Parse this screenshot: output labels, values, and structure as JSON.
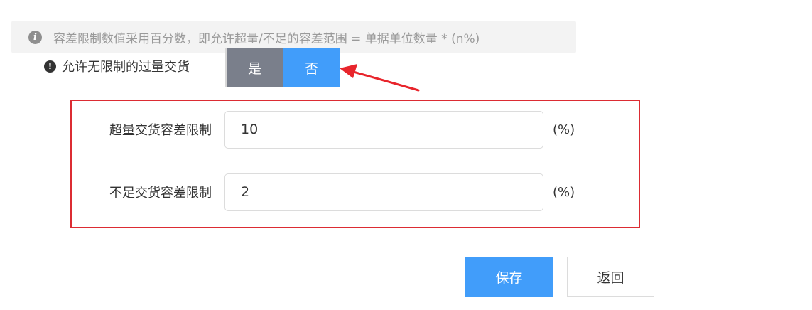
{
  "info": {
    "icon": "info-icon",
    "text": "容差限制数值采用百分数，即允许超量/不足的容差范围 = 单据单位数量 *  (n%)"
  },
  "toggle": {
    "icon": "warning-icon",
    "label": "允许无限制的过量交货",
    "options": [
      "是",
      "否"
    ],
    "selected": "否"
  },
  "fields": [
    {
      "label": "超量交货容差限制",
      "value": "10",
      "unit": "(%)"
    },
    {
      "label": "不足交货容差限制",
      "value": "2",
      "unit": "(%)"
    }
  ],
  "buttons": {
    "save": "保存",
    "back": "返回"
  },
  "colors": {
    "primary": "#419dfa",
    "toggle_inactive": "#7a7f8b",
    "highlight": "#dc2c33"
  }
}
